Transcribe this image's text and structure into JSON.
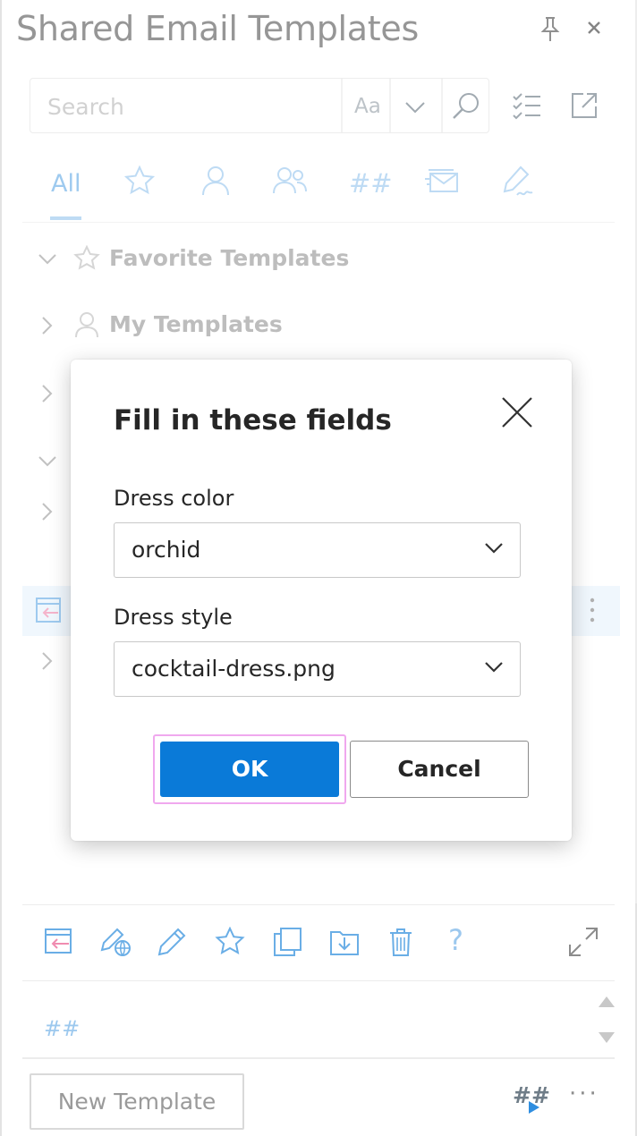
{
  "header": {
    "title": "Shared Email Templates",
    "pin_icon": "pin-icon",
    "close_icon": "close-icon"
  },
  "search": {
    "placeholder": "Search",
    "match_case_label": "Aa",
    "icons": [
      "chevron-down-icon",
      "search-icon",
      "checklist-icon",
      "open-external-icon"
    ]
  },
  "tabs": {
    "all_label": "All",
    "icon_tabs": [
      "star-icon",
      "person-icon",
      "people-icon",
      "hash-icon",
      "email-stack-icon",
      "signature-pen-icon"
    ]
  },
  "tree": {
    "favorite_label": "Favorite Templates",
    "my_label": "My Templates"
  },
  "dialog": {
    "title": "Fill in these fields",
    "field1_label": "Dress color",
    "field1_value": "orchid",
    "field2_label": "Dress style",
    "field2_value": "cocktail-dress.png",
    "ok_label": "OK",
    "cancel_label": "Cancel"
  },
  "toolbar": {
    "icons": [
      "insert-template-icon",
      "edit-web-icon",
      "edit-icon",
      "favorite-star-icon",
      "copy-icon",
      "move-to-folder-icon",
      "delete-icon",
      "help-icon",
      "expand-icon"
    ]
  },
  "preview": {
    "hash_text": "##"
  },
  "footer": {
    "new_template_label": "New Template",
    "macro_label": "##",
    "more_label": "···"
  },
  "colors": {
    "accent": "#0a7ad8",
    "icon_blue": "#6aaee6",
    "focus_ring": "#f0a8ee",
    "selection": "#e8f3fc"
  }
}
